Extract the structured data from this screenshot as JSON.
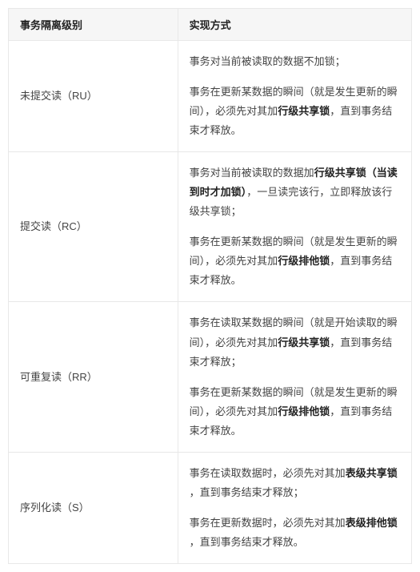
{
  "headers": {
    "level": "事务隔离级别",
    "impl": "实现方式"
  },
  "rows": [
    {
      "level": "未提交读（RU）",
      "impl_html": "<p>事务对当前被读取的数据不加锁；</p><p>事务在更新某数据的瞬间（就是发生更新的瞬间），必须先对其加<b>行级共享锁</b>，直到事务结束才释放。</p>"
    },
    {
      "level": "提交读（RC）",
      "impl_html": "<p>事务对当前被读取的数据加<b>行级共享锁（当读到时才加锁）</b>，一旦读完该行，立即释放该行级共享锁；</p><p>事务在更新某数据的瞬间（就是发生更新的瞬间），必须先对其加<b>行级排他锁</b>，直到事务结束才释放。</p>"
    },
    {
      "level": "可重复读（RR）",
      "impl_html": "<p>事务在读取某数据的瞬间（就是开始读取的瞬间），必须先对其加<b>行级共享锁</b>，直到事务结束才释放；</p><p>事务在更新某数据的瞬间（就是发生更新的瞬间），必须先对其加<b>行级排他锁</b>，直到事务结束才释放。</p>"
    },
    {
      "level": "序列化读（S）",
      "impl_html": "<p>事务在读取数据时，必须先对其加<b>表级共享锁</b> ，直到事务结束才释放；</p><p>事务在更新数据时，必须先对其加<b>表级排他锁</b> ，直到事务结束才释放。</p>"
    }
  ]
}
